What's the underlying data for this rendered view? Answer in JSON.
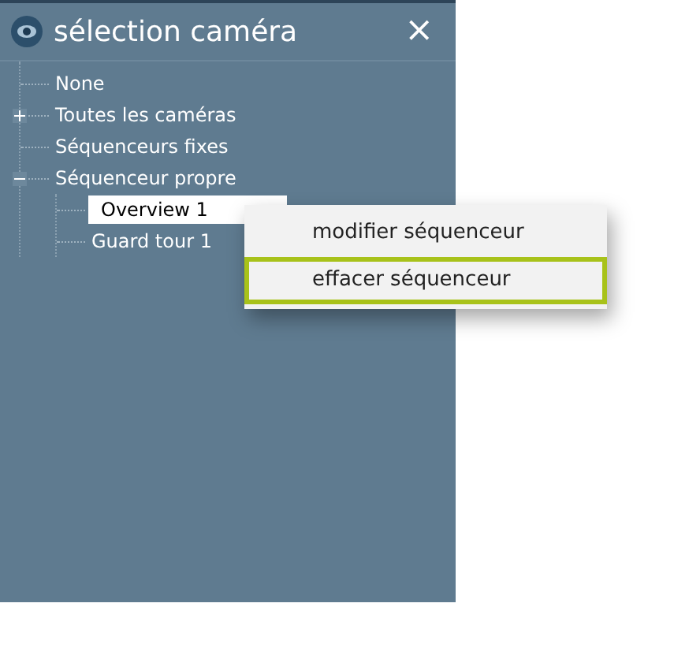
{
  "window": {
    "title": "sélection caméra",
    "close": "×"
  },
  "tree": [
    {
      "label": "None",
      "selected": false
    },
    {
      "label": "Toutes les caméras",
      "selected": false,
      "expanded": false
    },
    {
      "label": "Séquenceurs fixes",
      "selected": false
    },
    {
      "label": "Séquenceur propre",
      "selected": false,
      "expanded": true,
      "children": [
        {
          "label": "Overview 1",
          "selected": true
        },
        {
          "label": "Guard tour 1",
          "selected": false
        }
      ]
    }
  ],
  "context_menu": [
    {
      "label": "modifier séquenceur",
      "selected": false
    },
    {
      "label": "effacer séquenceur",
      "selected": true
    }
  ]
}
